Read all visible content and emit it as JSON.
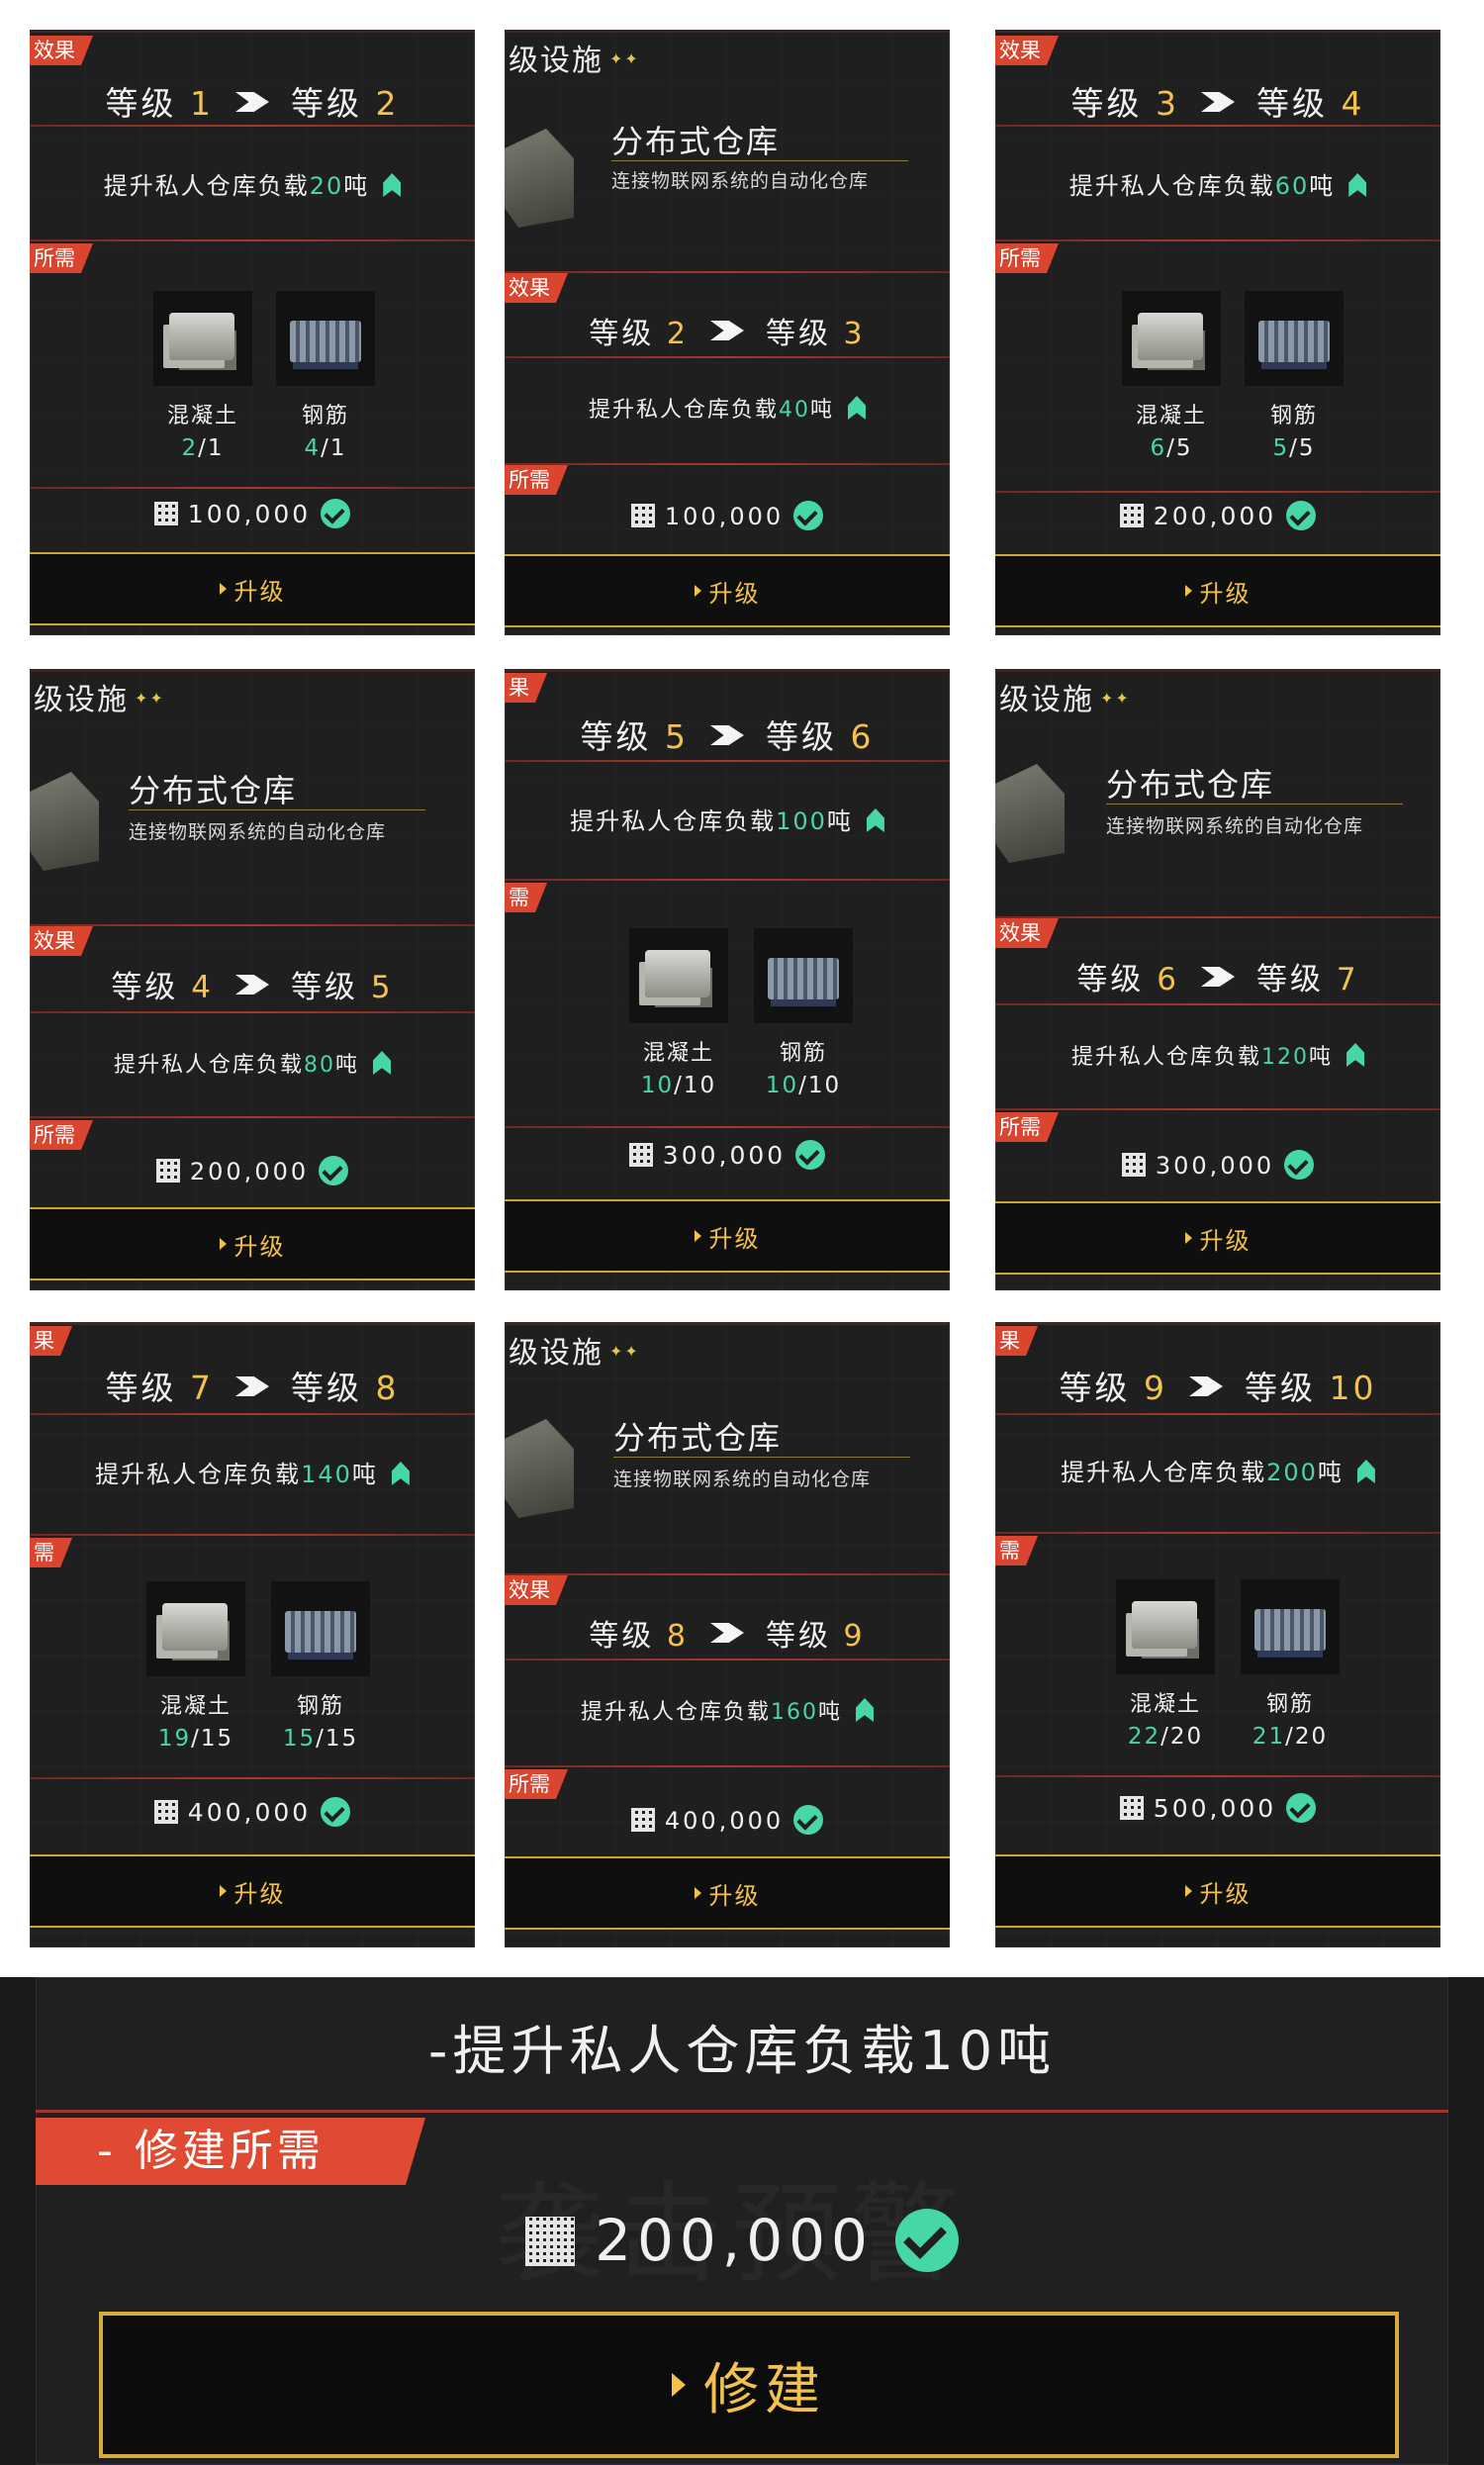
{
  "ui": {
    "tag_effect_cut": "效果",
    "tag_effect_cut2": "果",
    "tag_effect_full": "级效果",
    "tag_effect_full2": "效果",
    "tag_need_cut": "所需",
    "tag_need_cut2": "需",
    "tag_need_full": "级所需",
    "tag_need_full2": "所需",
    "upgrade_label": "升级",
    "level_word": "等级",
    "bonus_prefix": "提升私人仓库负载",
    "bonus_suffix": "吨",
    "facility_header": "级设施",
    "facility_name": "分布式仓库",
    "facility_desc": "连接物联网系统的自动化仓库",
    "material_concrete": "混凝土",
    "material_rebar": "钢筋"
  },
  "cards": [
    {
      "from": "1",
      "to": "2",
      "bonus": "20",
      "concrete": [
        "2",
        "1"
      ],
      "rebar": [
        "4",
        "1"
      ],
      "cost": "100,000"
    },
    {
      "from": "2",
      "to": "3",
      "bonus": "40",
      "cost": "100,000"
    },
    {
      "from": "3",
      "to": "4",
      "bonus": "60",
      "concrete": [
        "6",
        "5"
      ],
      "rebar": [
        "5",
        "5"
      ],
      "cost": "200,000"
    },
    {
      "from": "4",
      "to": "5",
      "bonus": "80",
      "cost": "200,000"
    },
    {
      "from": "5",
      "to": "6",
      "bonus": "100",
      "concrete": [
        "10",
        "10"
      ],
      "rebar": [
        "10",
        "10"
      ],
      "cost": "300,000"
    },
    {
      "from": "6",
      "to": "7",
      "bonus": "120",
      "cost": "300,000"
    },
    {
      "from": "7",
      "to": "8",
      "bonus": "140",
      "concrete": [
        "19",
        "15"
      ],
      "rebar": [
        "15",
        "15"
      ],
      "cost": "400,000"
    },
    {
      "from": "8",
      "to": "9",
      "bonus": "160",
      "cost": "400,000"
    },
    {
      "from": "9",
      "to": "10",
      "bonus": "200",
      "concrete": [
        "22",
        "20"
      ],
      "rebar": [
        "21",
        "20"
      ],
      "cost": "500,000"
    }
  ],
  "bottom": {
    "bonus_text": "-提升私人仓库负载10吨",
    "tag": "- 修建所需",
    "cost": "200,000",
    "build_label": "修建",
    "ghost_text": "袭击预警"
  },
  "colors": {
    "accent_green": "#47d6a6",
    "accent_gold": "#f2c14e",
    "tag_red": "#d9452f",
    "panel": "#1f1f20"
  }
}
